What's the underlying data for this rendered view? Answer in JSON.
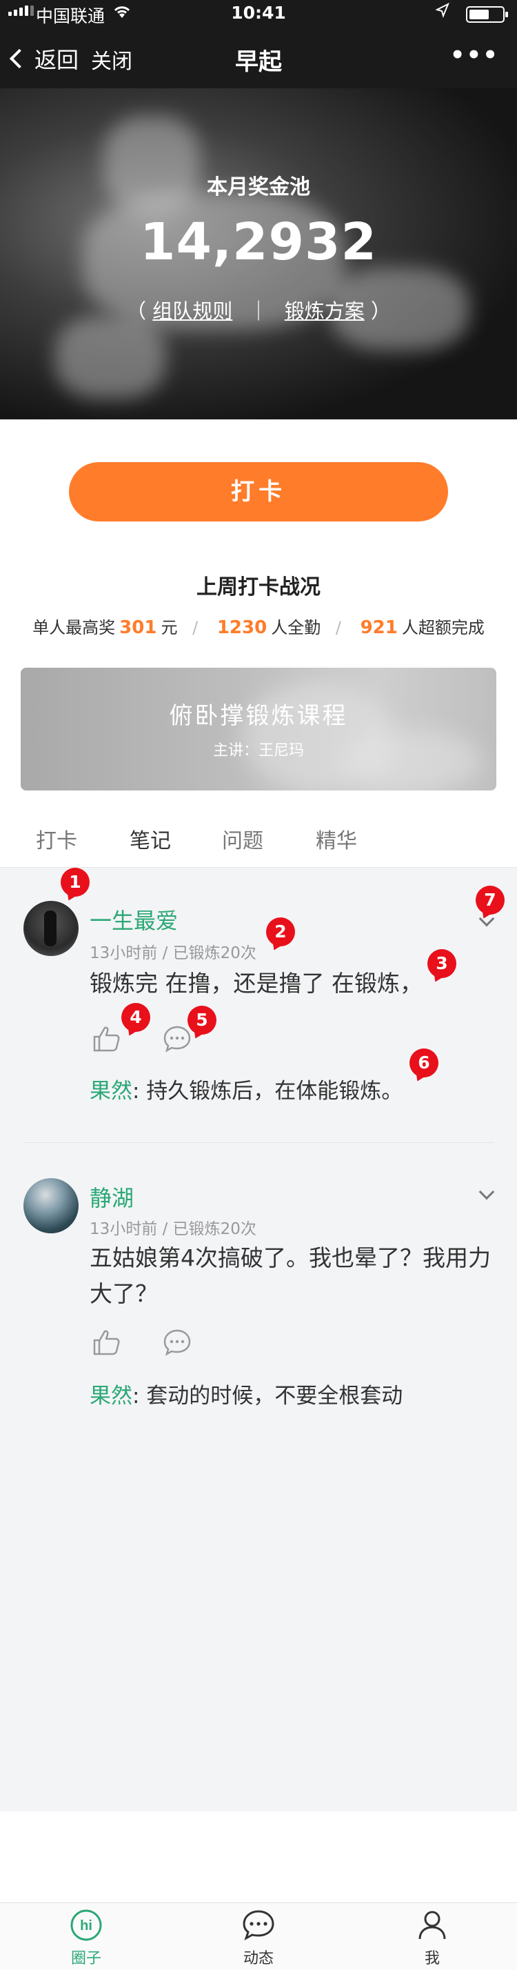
{
  "status_bar": {
    "carrier": "中国联通",
    "time": "10:41"
  },
  "nav": {
    "back_label": "返回",
    "close_label": "关闭",
    "title": "早起",
    "more_label": "•••"
  },
  "hero": {
    "pool_label": "本月奖金池",
    "pool_amount": "14,2932",
    "link_open": "（",
    "link_rules": "组队规则",
    "link_sep": "｜",
    "link_plan": "锻炼方案",
    "link_close": "）"
  },
  "checkin_button": "打卡",
  "last_week": {
    "title": "上周打卡战况",
    "top_prize_label": "单人最高奖",
    "top_prize_value": "301",
    "top_prize_unit": "元",
    "full_attendance_value": "1230",
    "full_attendance_label": "人全勤",
    "overachieve_value": "921",
    "overachieve_label": "人超额完成",
    "separator": "/"
  },
  "course": {
    "title": "俯卧撑锻炼课程",
    "lecturer": "主讲：王尼玛"
  },
  "tabs": [
    {
      "label": "打卡"
    },
    {
      "label": "笔记"
    },
    {
      "label": "问题"
    },
    {
      "label": "精华"
    }
  ],
  "posts": [
    {
      "user": "一生最爱",
      "meta": "13小时前 / 已锻炼20次",
      "content": "锻炼完 在撸，还是撸了 在锻炼，",
      "reply_user": "果然",
      "reply_text": ": 持久锻炼后，在体能锻炼。"
    },
    {
      "user": "静湖",
      "meta": "13小时前 / 已锻炼20次",
      "content": "五姑娘第4次搞破了。我也晕了？我用力大了？",
      "reply_user": "果然",
      "reply_text": ": 套动的时候，不要全根套动"
    }
  ],
  "annotations": [
    "1",
    "2",
    "3",
    "4",
    "5",
    "6",
    "7"
  ],
  "bottom_tabs": [
    {
      "label": "圈子",
      "icon": "hi-circle-icon"
    },
    {
      "label": "动态",
      "icon": "chat-bubble-icon"
    },
    {
      "label": "我",
      "icon": "person-icon"
    }
  ],
  "colors": {
    "accent": "#ff7c2b",
    "username": "#2aa876",
    "badge": "#e8101b"
  }
}
